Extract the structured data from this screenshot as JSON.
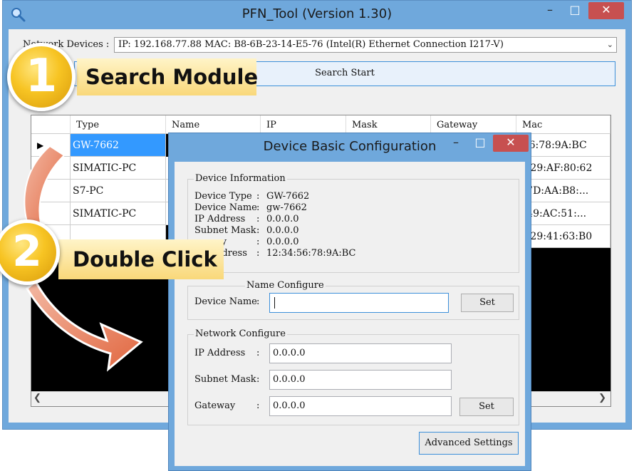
{
  "main_window": {
    "title": "PFN_Tool (Version 1.30)",
    "controls": {
      "minimize": "–",
      "maximize": "□",
      "close": "✕"
    }
  },
  "network": {
    "label": "Network Devices :",
    "selected": "IP: 192.168.77.88  MAC: B8-6B-23-14-E5-76 (Intel(R) Ethernet Connection I217-V)"
  },
  "search_button": "Search Start",
  "table": {
    "columns": [
      "Type",
      "Name",
      "IP",
      "Mask",
      "Gateway",
      "Mac"
    ],
    "rows": [
      {
        "type": "GW-7662",
        "mac": ":56:78:9A:BC"
      },
      {
        "type": "SIMATIC-PC",
        "name": "i",
        "mac": "C:29:AF:80:62"
      },
      {
        "type": "S7-PC",
        "name": "i",
        "mac": "):7D:AA:B8:..."
      },
      {
        "type": "SIMATIC-PC",
        "name": "r",
        "mac": "):49:AC:51:..."
      },
      {
        "type": "",
        "name": "",
        "mac": "C:29:41:63:B0"
      }
    ]
  },
  "callouts": {
    "step1": {
      "number": "1",
      "label": "Search Module"
    },
    "step2": {
      "number": "2",
      "label": "Double Click"
    }
  },
  "dialog": {
    "title": "Device Basic Configuration",
    "controls": {
      "minimize": "–",
      "maximize": "□",
      "close": "✕"
    },
    "device_info": {
      "caption": "Device Information",
      "labels": [
        "Device Type",
        "Device Name",
        "IP Address",
        "Subnet Mask",
        "ay",
        "ddress"
      ],
      "values": [
        "GW-7662",
        "gw-7662",
        "0.0.0.0",
        "0.0.0.0",
        "0.0.0.0",
        "12:34:56:78:9A:BC"
      ]
    },
    "name_config": {
      "caption": "Name Configure",
      "label": "Device Name",
      "value": "",
      "set_label": "Set"
    },
    "network_config": {
      "caption": "Network Configure",
      "ip_label": "IP Address",
      "ip_value": "0.0.0.0",
      "mask_label": "Subnet Mask",
      "mask_value": "0.0.0.0",
      "gateway_label": "Gateway",
      "gateway_value": "0.0.0.0",
      "set_label": "Set"
    },
    "advanced_button": "Advanced Settings"
  },
  "colors": {
    "title_bar": "#6fa8dc",
    "close_button": "#c75050",
    "selected_row": "#3399ff",
    "callout_gold": "#f7c423",
    "arrow": "#e2704f"
  }
}
